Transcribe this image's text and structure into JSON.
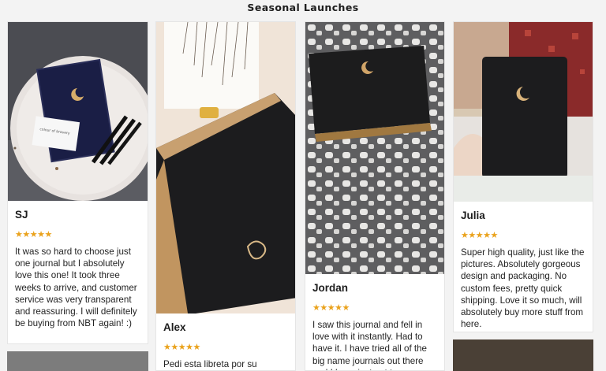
{
  "section": {
    "title": "Seasonal Launches"
  },
  "rating_color": "#eaa21c",
  "reviews": [
    {
      "name": "SJ",
      "stars": "★★★★★",
      "rating": 5,
      "text": "It was so hard to choose just one journal but I absolutely love this one! It took three weeks to arrive, and customer service was very transparent and reassuring. I will definitely be buying from NBT again! :)"
    },
    {
      "name": "Alex",
      "stars": "★★★★★",
      "rating": 5,
      "text": "Pedi esta libreta por su"
    },
    {
      "name": "Jordan",
      "stars": "★★★★★",
      "rating": 5,
      "text": "I saw this journal and fell in love with it instantly. Had to have it. I have tried all of the big name journals out there and I have just got to say"
    },
    {
      "name": "Julia",
      "stars": "★★★★★",
      "rating": 5,
      "text": "Super high quality, just like the pictures. Absolutely gorgeous design and packaging. No custom fees, pretty quick shipping. Love it so much, will absolutely buy more stuff from here."
    }
  ],
  "photos": [
    {
      "icon": "moon-journal-photo",
      "note_card": "colour of bravery"
    },
    {
      "icon": "moon-journal-photo"
    },
    {
      "icon": "moon-journal-photo"
    },
    {
      "icon": "moon-journal-photo"
    }
  ]
}
